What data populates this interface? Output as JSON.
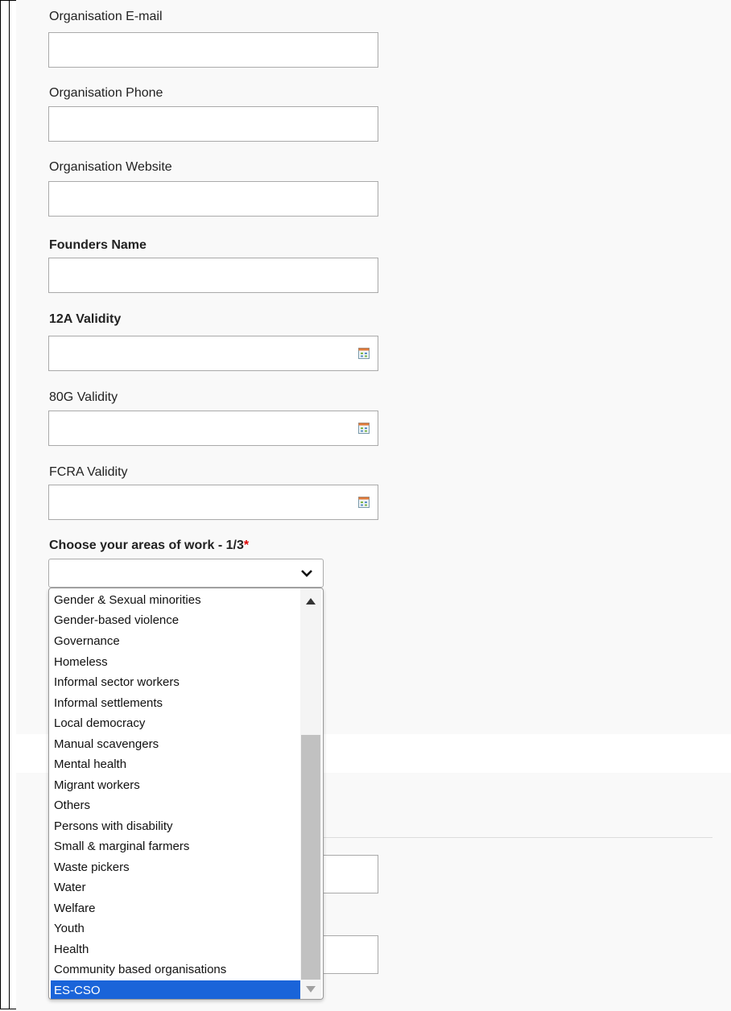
{
  "form": {
    "fields": [
      {
        "label": "Organisation E-mail",
        "value": ""
      },
      {
        "label": "Organisation Phone",
        "value": ""
      },
      {
        "label": "Organisation Website",
        "value": ""
      },
      {
        "label": "Founders Name",
        "value": ""
      },
      {
        "label": "12A Validity",
        "value": "",
        "icon": "calendar-icon"
      },
      {
        "label": "80G Validity",
        "value": "",
        "icon": "calendar-icon"
      },
      {
        "label": "FCRA Validity",
        "value": "",
        "icon": "calendar-icon"
      }
    ],
    "areas_of_work": {
      "label": "Choose your areas of work - 1/3",
      "required_mark": "*",
      "selected_value": "",
      "options": [
        "Gender & Sexual minorities",
        "Gender-based violence",
        "Governance",
        "Homeless",
        "Informal sector workers",
        "Informal settlements",
        "Local democracy",
        "Manual scavengers",
        "Mental health",
        "Migrant workers",
        "Others",
        "Persons with disability",
        "Small & marginal farmers",
        "Waste pickers",
        "Water",
        "Welfare",
        "Youth",
        "Health",
        "Community based organisations",
        "ES-CSO"
      ],
      "highlighted_option": "ES-CSO"
    }
  },
  "colors": {
    "highlight": "#1a64d9",
    "required": "#dd0000",
    "field_border": "#aaaaaa"
  }
}
